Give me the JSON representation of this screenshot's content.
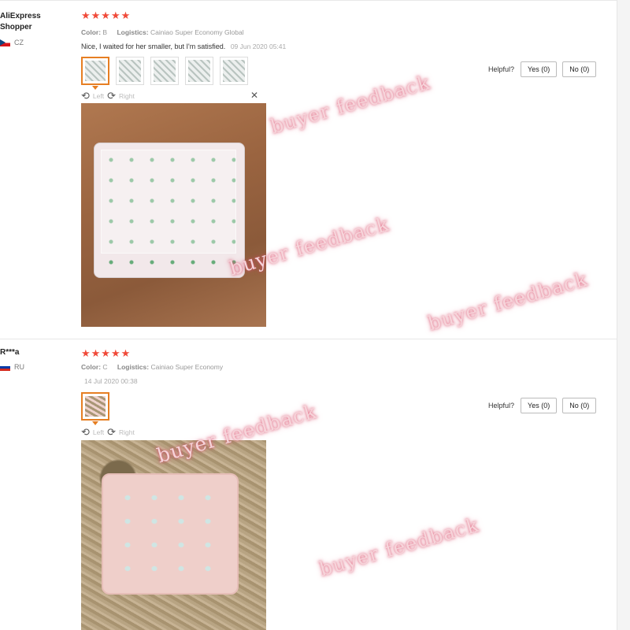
{
  "reviews": [
    {
      "user_name": "AliExpress Shopper",
      "country": "CZ",
      "stars": "★★★★★",
      "color_label": "Color:",
      "color_value": "B",
      "logistics_label": "Logistics:",
      "logistics_value": "Cainiao Super Economy Global",
      "comment": "Nice, I waited for her smaller, but I'm satisfied.",
      "date": "09 Jun 2020 05:41",
      "viewer_left": "Left",
      "viewer_right": "Right",
      "helpful_label": "Helpful?",
      "yes_label": "Yes (0)",
      "no_label": "No (0)"
    },
    {
      "user_name": "R***a",
      "country": "RU",
      "stars": "★★★★★",
      "color_label": "Color:",
      "color_value": "C",
      "logistics_label": "Logistics:",
      "logistics_value": "Cainiao Super Economy",
      "comment": "",
      "date": "14 Jul 2020 00:38",
      "viewer_left": "Left",
      "viewer_right": "Right",
      "helpful_label": "Helpful?",
      "yes_label": "Yes (0)",
      "no_label": "No (0)"
    }
  ],
  "watermark": "buyer feedback",
  "icons": {
    "rotate_left": "rotate-left-icon",
    "rotate_right": "rotate-right-icon",
    "close": "close-icon"
  },
  "colors": {
    "stars": "#f04a39",
    "active_thumb": "#e67e22"
  }
}
